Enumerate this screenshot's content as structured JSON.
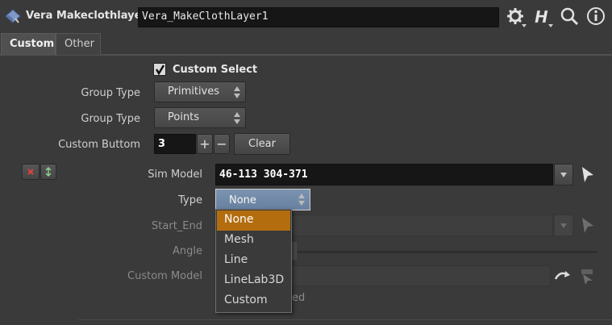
{
  "header": {
    "node_label": "Vera Makeclothlayer",
    "node_name": "Vera_MakeClothLayer1",
    "icons": [
      "gear-icon",
      "houdini-help-icon",
      "search-icon",
      "info-icon"
    ]
  },
  "tabs": [
    {
      "label": "Custom",
      "active": true
    },
    {
      "label": "Other",
      "active": false
    }
  ],
  "params": {
    "custom_select": {
      "label": "Custom Select",
      "checked": true
    },
    "group_type_1": {
      "label": "Group Type",
      "value": "Primitives"
    },
    "group_type_2": {
      "label": "Group Type",
      "value": "Points"
    },
    "custom_buttom": {
      "label": "Custom Buttom",
      "value": "3",
      "plus": "+",
      "minus": "−",
      "clear": "Clear"
    },
    "sim_model": {
      "label": "Sim Model",
      "value": "46-113 304-371"
    },
    "type": {
      "label": "Type",
      "value": "None"
    },
    "start_end": {
      "label": "Start_End"
    },
    "angle": {
      "label": "Angle"
    },
    "custom_model": {
      "label": "Custom Model",
      "partial_text": "ed"
    }
  },
  "type_menu": {
    "options": [
      "None",
      "Mesh",
      "Line",
      "LineLab3D",
      "Custom"
    ],
    "selected": "None"
  },
  "colors": {
    "background": "#3a3a3a",
    "field": "#161616",
    "highlight": "#b36d0e",
    "menu_selected": "#7089a6"
  }
}
